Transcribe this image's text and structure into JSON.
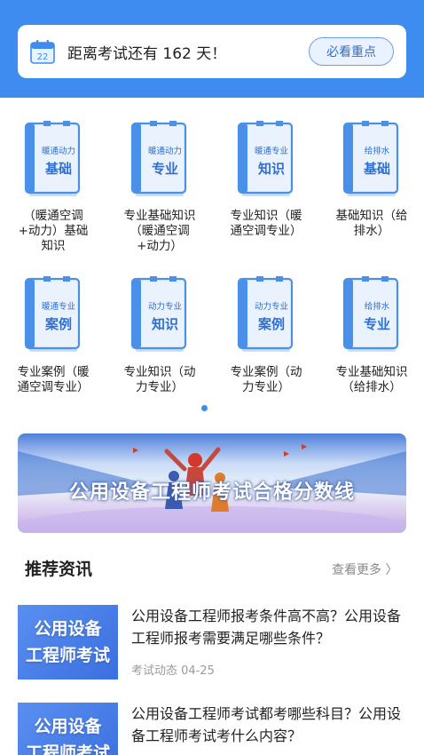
{
  "header": {
    "calendar_day": "22",
    "countdown_text": "距离考试还有 162 天！",
    "must_button_label": "必看重点"
  },
  "categories": [
    {
      "book_top": "暖通动力",
      "book_main": "基础",
      "label": "（暖通空调\n+动力）基础\n知识"
    },
    {
      "book_top": "暖通动力",
      "book_main": "专业",
      "label": "专业基础知识\n（暖通空调\n+动力）"
    },
    {
      "book_top": "暖通专业",
      "book_main": "知识",
      "label": "专业知识（暖\n通空调专业）"
    },
    {
      "book_top": "给排水",
      "book_main": "基础",
      "label": "基础知识（给\n排水）"
    },
    {
      "book_top": "暖通专业",
      "book_main": "案例",
      "label": "专业案例（暖\n通空调专业）"
    },
    {
      "book_top": "动力专业",
      "book_main": "知识",
      "label": "专业知识（动\n力专业）"
    },
    {
      "book_top": "动力专业",
      "book_main": "案例",
      "label": "专业案例（动\n力专业）"
    },
    {
      "book_top": "给排水",
      "book_main": "专业",
      "label": "专业基础知识\n（给排水）"
    }
  ],
  "banner": {
    "title": "公用设备工程师考试合格分数线"
  },
  "news_section": {
    "title": "推荐资讯",
    "more_label": "查看更多 〉"
  },
  "news": [
    {
      "thumb_line1": "公用设备",
      "thumb_line2": "工程师考试",
      "title": "公用设备工程师报考条件高不高？公用设备工程师报考需要满足哪些条件？",
      "meta": "考试动态  04-25"
    },
    {
      "thumb_line1": "公用设备",
      "thumb_line2": "工程师考试",
      "title": "公用设备工程师考试都考哪些科目？公用设备工程师考试考什么内容？",
      "meta": ""
    }
  ],
  "colors": {
    "brand_blue": "#3f8cf0",
    "book_blue": "#4a90e8",
    "book_light": "#eaf3fd"
  }
}
